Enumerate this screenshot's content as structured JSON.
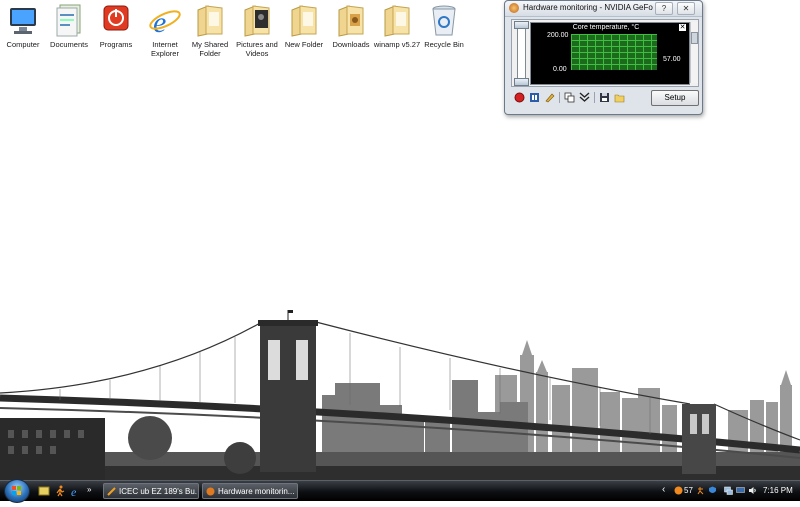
{
  "desktop": {
    "icons": [
      {
        "label": "Computer",
        "icon": "computer-icon"
      },
      {
        "label": "Documents",
        "icon": "documents-icon"
      },
      {
        "label": "Programs",
        "icon": "programs-icon"
      },
      {
        "label": "Internet Explorer",
        "icon": "internet-explorer-icon"
      },
      {
        "label": "My Shared Folder",
        "icon": "folder-icon"
      },
      {
        "label": "Pictures and Videos",
        "icon": "pictures-folder-icon"
      },
      {
        "label": "New Folder",
        "icon": "folder-icon"
      },
      {
        "label": "Downloads",
        "icon": "downloads-folder-icon"
      },
      {
        "label": "winamp v5.27",
        "icon": "folder-icon"
      },
      {
        "label": "Recycle Bin",
        "icon": "recycle-bin-icon"
      }
    ]
  },
  "hwmon": {
    "title": "Hardware monitoring - NVIDIA GeFor...",
    "help_label": "?",
    "close_label": "✕",
    "graph": {
      "title": "Core temperature, °C",
      "ymax": "200.00",
      "ymin": "0.00",
      "current": "57.00",
      "close_glyph": "✕"
    },
    "setup_label": "Setup",
    "toolbar_icons": [
      "record-icon",
      "pause-icon",
      "pen-icon",
      "copy-icon",
      "collapse-icon",
      "save-icon",
      "folder-icon"
    ]
  },
  "taskbar": {
    "buttons": [
      {
        "label": "ICEC ub EZ 189's Bu...",
        "icon": "app-icon"
      },
      {
        "label": "Hardware monitorin...",
        "icon": "hwmon-icon"
      }
    ],
    "tray": {
      "temperature": "57",
      "clock": "7:16 PM",
      "expand_glyph": "‹"
    }
  },
  "colors": {
    "taskbar": "#0d0f12",
    "graph_bg": "#000000",
    "graph_grid": "#3fbf3f",
    "graph_fill": "#1c6b1c"
  }
}
